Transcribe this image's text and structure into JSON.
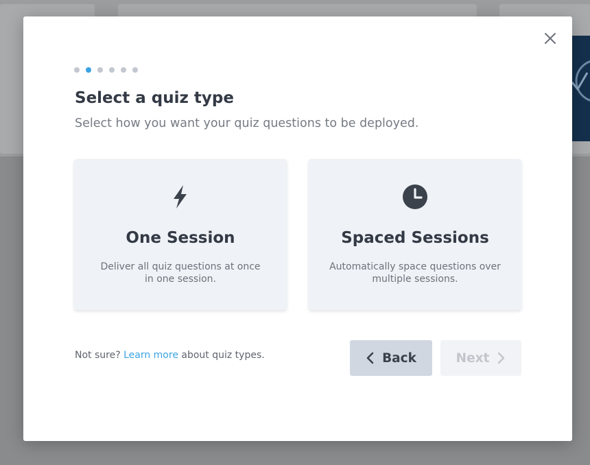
{
  "modal": {
    "steps": [
      {
        "active": false
      },
      {
        "active": true
      },
      {
        "active": false
      },
      {
        "active": false
      },
      {
        "active": false
      },
      {
        "active": false
      }
    ],
    "title": "Select a quiz type",
    "subtitle": "Select how you want your quiz questions to be deployed.",
    "options": [
      {
        "icon": "lightning-icon",
        "title": "One Session",
        "description": "Deliver all quiz questions at once in one session."
      },
      {
        "icon": "clock-icon",
        "title": "Spaced Sessions",
        "description": "Automatically space questions over multiple sessions."
      }
    ],
    "hint": {
      "prefix": "Not sure?",
      "link": "Learn more",
      "suffix": "about quiz types."
    },
    "buttons": {
      "back": "Back",
      "next": "Next",
      "next_disabled": true
    },
    "close_icon": "close-icon"
  },
  "colors": {
    "accent": "#3aa3e3",
    "text_dark": "#333a45",
    "card_bg": "#eff2f6",
    "overlay": "#8a8b8d"
  }
}
